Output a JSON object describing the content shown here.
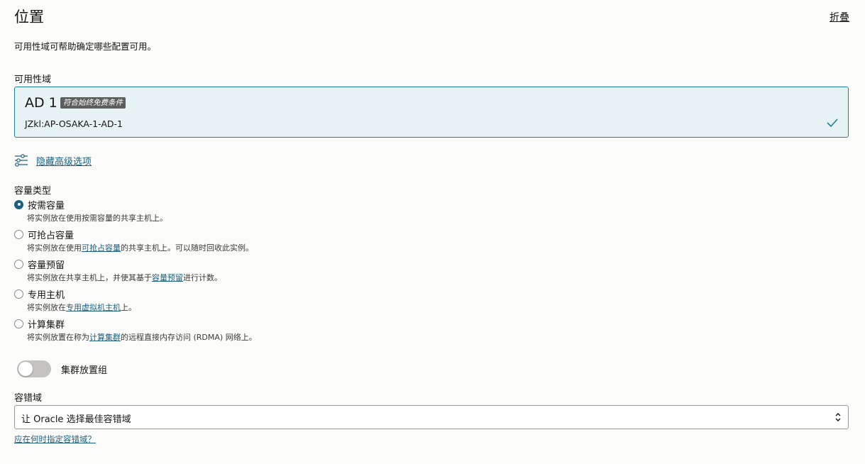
{
  "header": {
    "title": "位置",
    "collapse_label": "折叠"
  },
  "description": "可用性域可帮助确定哪些配置可用。",
  "availability_domain": {
    "label": "可用性域",
    "selected": {
      "name": "AD 1",
      "badge": "符合始终免费条件",
      "full_name": "JZkl:AP-OSAKA-1-AD-1"
    },
    "accent_color": "#227e9e",
    "background_color": "#e7f2f5"
  },
  "advanced": {
    "toggle_label": "隐藏高级选项",
    "icon": "sliders-icon"
  },
  "capacity_type": {
    "label": "容量类型",
    "options": [
      {
        "label": "按需容量",
        "selected": true,
        "desc_before": "将实例放在使用按需容量的共享主机上。",
        "desc_link": "",
        "desc_after": ""
      },
      {
        "label": "可抢占容量",
        "selected": false,
        "desc_before": "将实例放在使用",
        "desc_link": "可抢占容量",
        "desc_after": "的共享主机上。可以随时回收此实例。"
      },
      {
        "label": "容量预留",
        "selected": false,
        "desc_before": "将实例放在共享主机上，并使其基于",
        "desc_link": "容量预留",
        "desc_after": "进行计数。"
      },
      {
        "label": "专用主机",
        "selected": false,
        "desc_before": "将实例放在",
        "desc_link": "专用虚拟机主机",
        "desc_after": "上。"
      },
      {
        "label": "计算集群",
        "selected": false,
        "desc_before": "将实例放置在称为",
        "desc_link": "计算集群",
        "desc_after": "的远程直接内存访问 (RDMA) 网络上。"
      }
    ]
  },
  "cluster_placement": {
    "label": "集群放置组",
    "enabled": false
  },
  "fault_domain": {
    "label": "容错域",
    "value": "让 Oracle 选择最佳容错域",
    "help_link": "应在何时指定容错域？"
  },
  "colors": {
    "link": "#1c607f",
    "radio_selected": "#1c607f",
    "switch_off": "#c5c3c0"
  }
}
